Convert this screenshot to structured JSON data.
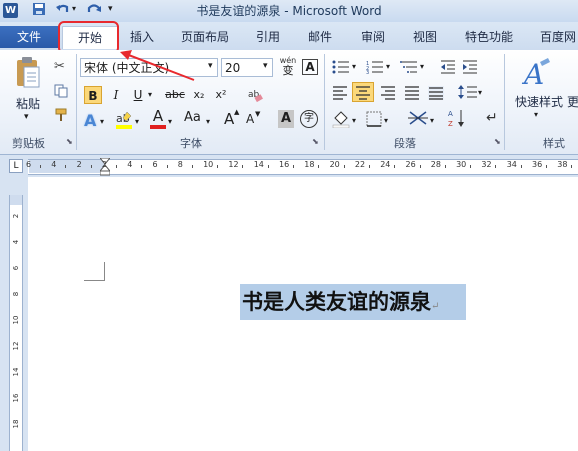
{
  "window": {
    "title": "书是友谊的源泉  -  Microsoft Word",
    "app_icon": "word-icon"
  },
  "quick_access": [
    "save-icon",
    "undo-icon",
    "redo-icon",
    "customize-icon"
  ],
  "tabs": {
    "file": "文件",
    "items": [
      "开始",
      "插入",
      "页面布局",
      "引用",
      "邮件",
      "审阅",
      "视图",
      "特色功能",
      "百度网"
    ],
    "active": "开始"
  },
  "ribbon": {
    "clipboard": {
      "paste": "粘贴",
      "label": "剪贴板"
    },
    "font": {
      "family": "宋体 (中文正文)",
      "size": "20",
      "label": "字体",
      "wen": "wén",
      "wen_char": "变",
      "a_box": "A",
      "bold": "B",
      "italic": "I",
      "underline": "U",
      "strike": "abc",
      "sub": "x₂",
      "sup": "x²",
      "grow": "A",
      "shrink": "A",
      "case": "Aa",
      "color_a": "A",
      "shade_a": "A",
      "char_border": "字"
    },
    "paragraph": {
      "label": "段落"
    },
    "styles": {
      "quick": "快速样式",
      "change": "更",
      "label": "样式"
    }
  },
  "ruler": {
    "ticks": [
      "6",
      "4",
      "2",
      "2",
      "4",
      "6",
      "8",
      "10",
      "12",
      "14",
      "16",
      "18",
      "20",
      "22",
      "24",
      "26",
      "28",
      "30",
      "32",
      "34",
      "36",
      "38"
    ],
    "vticks": [
      "2",
      "4",
      "6",
      "8",
      "10",
      "12",
      "14",
      "16",
      "18"
    ]
  },
  "document": {
    "text": "书是人类友谊的源泉",
    "para_mark": "↵"
  },
  "colors": {
    "accent": "#2a5aa8",
    "selection": "#b4cde8",
    "highlight_box": "#e8292e"
  }
}
